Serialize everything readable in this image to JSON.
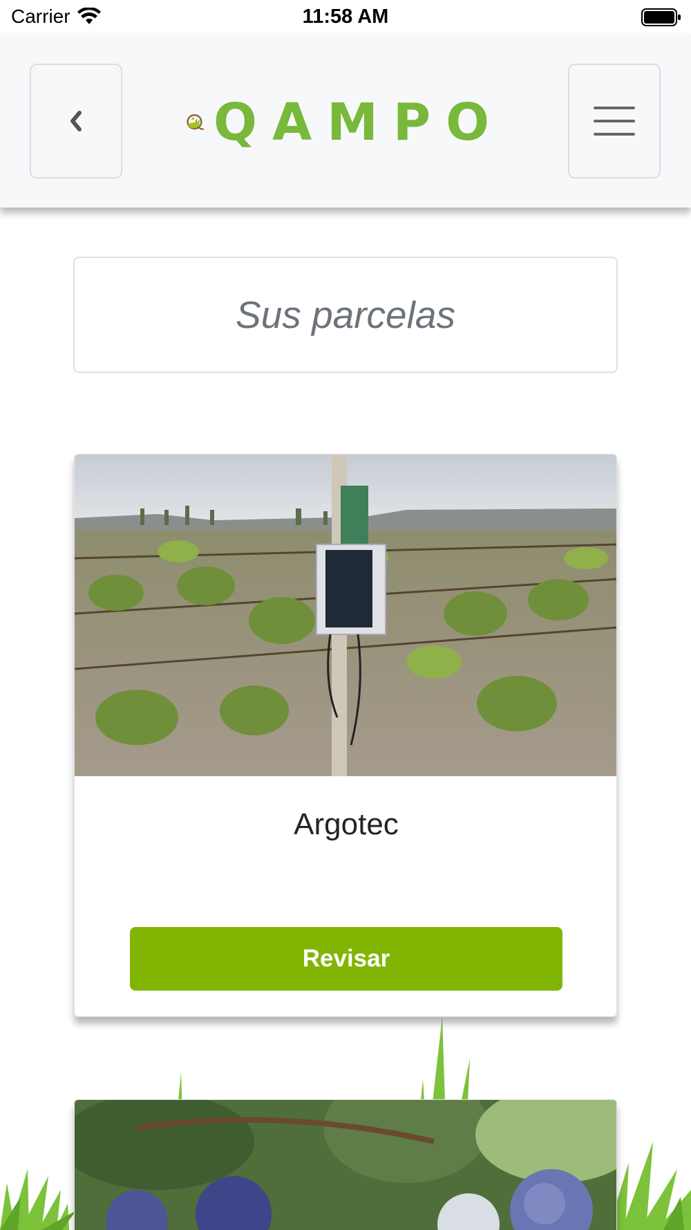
{
  "status_bar": {
    "carrier": "Carrier",
    "time": "11:58 AM",
    "icons": [
      "wifi-icon",
      "battery-icon"
    ]
  },
  "header": {
    "back_icon": "chevron-left-icon",
    "menu_icon": "hamburger-menu-icon",
    "logo_text": "QAMPO",
    "logo_color": "#78b83a"
  },
  "page_title": "Sus parcelas",
  "parcels": [
    {
      "name": "Argotec",
      "button_label": "Revisar",
      "image": "vineyard-with-weather-station"
    },
    {
      "image": "blueberries-on-bush"
    }
  ],
  "colors": {
    "accent": "#82b503",
    "header_bg": "#f7f8fa",
    "title_text": "#6c737a"
  }
}
